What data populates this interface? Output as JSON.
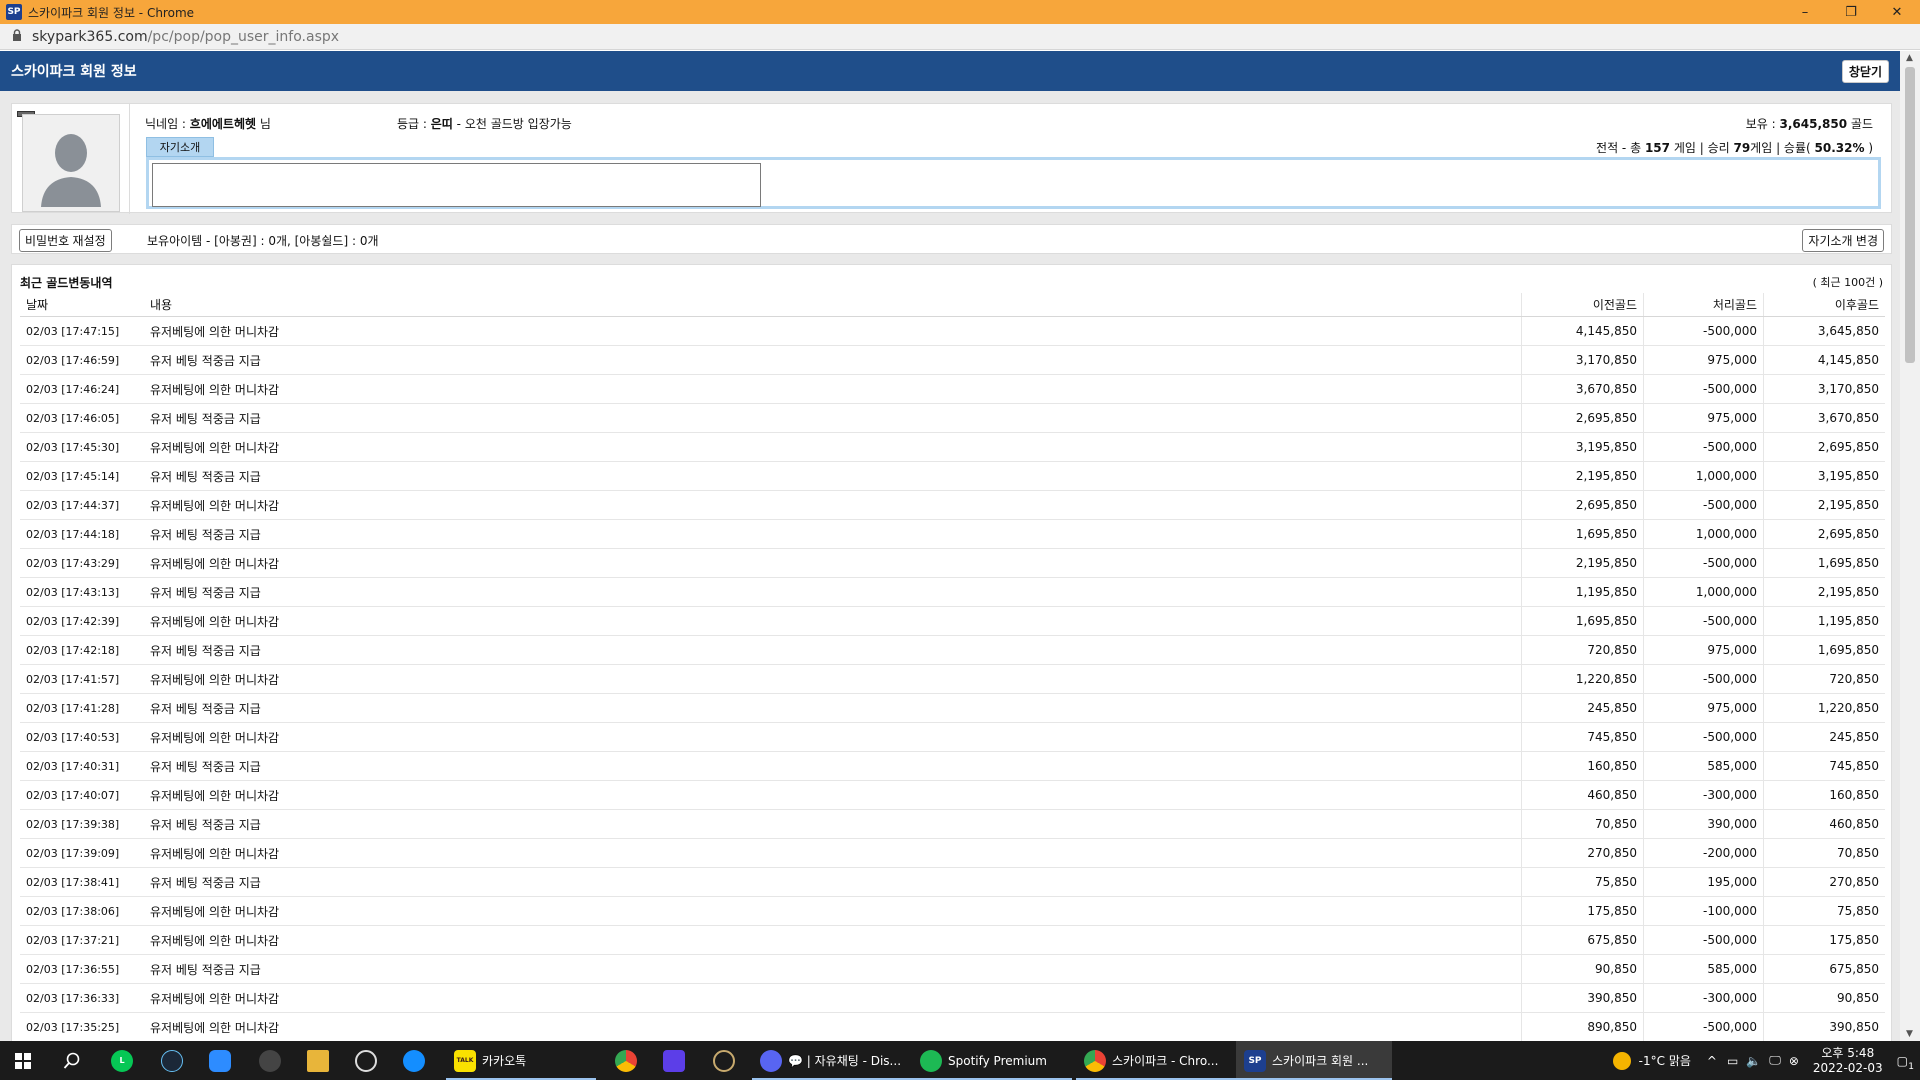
{
  "window": {
    "favicon": "SP",
    "title": "스카이파크 회원 정보 - Chrome",
    "controls": {
      "minimize": "–",
      "maximize": "❐",
      "close": "✕"
    }
  },
  "address": {
    "domain": "skypark365.com",
    "path": "/pc/pop/pop_user_info.aspx"
  },
  "header": {
    "title": "스카이파크 회원 정보",
    "close_label": "창닫기"
  },
  "profile": {
    "nickname_label": "닉네임 : ",
    "nickname": "흐에에트헤헷",
    "nickname_suffix": " 님",
    "grade_label": "등급 : ",
    "grade": "은띠",
    "grade_desc": " - 오천 골드방 입장가능",
    "holding_label": "보유 : ",
    "holding": "3,645,850",
    "holding_unit": " 골드",
    "intro_tab": "자기소개",
    "record_prefix": "전적 - 총 ",
    "record_total": "157",
    "record_mid": " 게임 | 승리 ",
    "record_win": "79",
    "record_mid2": "게임 | 승률( ",
    "record_rate": "50.32%",
    "record_suffix": " )",
    "intro_value": ""
  },
  "items_bar": {
    "pw_button": "비밀번호 재설정",
    "items_text": "보유아이템 - [아봉권] : 0개, [아봉쉴드] : 0개",
    "intro_button": "자기소개 변경"
  },
  "history": {
    "title": "최근 골드변동내역",
    "count": "( 최근 100건 )",
    "columns": [
      "날짜",
      "내용",
      "이전골드",
      "처리골드",
      "이후골드"
    ],
    "rows": [
      [
        "02/03 [17:47:15]",
        "유저베팅에 의한 머니차감",
        "4,145,850",
        "-500,000",
        "3,645,850"
      ],
      [
        "02/03 [17:46:59]",
        "유저 베팅 적중금 지급",
        "3,170,850",
        "975,000",
        "4,145,850"
      ],
      [
        "02/03 [17:46:24]",
        "유저베팅에 의한 머니차감",
        "3,670,850",
        "-500,000",
        "3,170,850"
      ],
      [
        "02/03 [17:46:05]",
        "유저 베팅 적중금 지급",
        "2,695,850",
        "975,000",
        "3,670,850"
      ],
      [
        "02/03 [17:45:30]",
        "유저베팅에 의한 머니차감",
        "3,195,850",
        "-500,000",
        "2,695,850"
      ],
      [
        "02/03 [17:45:14]",
        "유저 베팅 적중금 지급",
        "2,195,850",
        "1,000,000",
        "3,195,850"
      ],
      [
        "02/03 [17:44:37]",
        "유저베팅에 의한 머니차감",
        "2,695,850",
        "-500,000",
        "2,195,850"
      ],
      [
        "02/03 [17:44:18]",
        "유저 베팅 적중금 지급",
        "1,695,850",
        "1,000,000",
        "2,695,850"
      ],
      [
        "02/03 [17:43:29]",
        "유저베팅에 의한 머니차감",
        "2,195,850",
        "-500,000",
        "1,695,850"
      ],
      [
        "02/03 [17:43:13]",
        "유저 베팅 적중금 지급",
        "1,195,850",
        "1,000,000",
        "2,195,850"
      ],
      [
        "02/03 [17:42:39]",
        "유저베팅에 의한 머니차감",
        "1,695,850",
        "-500,000",
        "1,195,850"
      ],
      [
        "02/03 [17:42:18]",
        "유저 베팅 적중금 지급",
        "720,850",
        "975,000",
        "1,695,850"
      ],
      [
        "02/03 [17:41:57]",
        "유저베팅에 의한 머니차감",
        "1,220,850",
        "-500,000",
        "720,850"
      ],
      [
        "02/03 [17:41:28]",
        "유저 베팅 적중금 지급",
        "245,850",
        "975,000",
        "1,220,850"
      ],
      [
        "02/03 [17:40:53]",
        "유저베팅에 의한 머니차감",
        "745,850",
        "-500,000",
        "245,850"
      ],
      [
        "02/03 [17:40:31]",
        "유저 베팅 적중금 지급",
        "160,850",
        "585,000",
        "745,850"
      ],
      [
        "02/03 [17:40:07]",
        "유저베팅에 의한 머니차감",
        "460,850",
        "-300,000",
        "160,850"
      ],
      [
        "02/03 [17:39:38]",
        "유저 베팅 적중금 지급",
        "70,850",
        "390,000",
        "460,850"
      ],
      [
        "02/03 [17:39:09]",
        "유저베팅에 의한 머니차감",
        "270,850",
        "-200,000",
        "70,850"
      ],
      [
        "02/03 [17:38:41]",
        "유저 베팅 적중금 지급",
        "75,850",
        "195,000",
        "270,850"
      ],
      [
        "02/03 [17:38:06]",
        "유저베팅에 의한 머니차감",
        "175,850",
        "-100,000",
        "75,850"
      ],
      [
        "02/03 [17:37:21]",
        "유저베팅에 의한 머니차감",
        "675,850",
        "-500,000",
        "175,850"
      ],
      [
        "02/03 [17:36:55]",
        "유저 베팅 적중금 지급",
        "90,850",
        "585,000",
        "675,850"
      ],
      [
        "02/03 [17:36:33]",
        "유저베팅에 의한 머니차감",
        "390,850",
        "-300,000",
        "90,850"
      ],
      [
        "02/03 [17:35:25]",
        "유저베팅에 의한 머니차감",
        "890,850",
        "-500,000",
        "390,850"
      ]
    ]
  },
  "taskbar": {
    "kakao_label": "카카오톡",
    "discord_label": "💬 | 자유채팅 - Dis...",
    "spotify_label": "Spotify Premium",
    "chrome_label": "스카이파크 - Chro...",
    "skypark_label": "스카이파크 회원 ...",
    "weather": "-1°C  맑음",
    "time": "오후 5:48",
    "date": "2022-02-03",
    "notif_count": "1",
    "kakao_icon_text": "TALK",
    "skypark_icon_text": "SP"
  }
}
